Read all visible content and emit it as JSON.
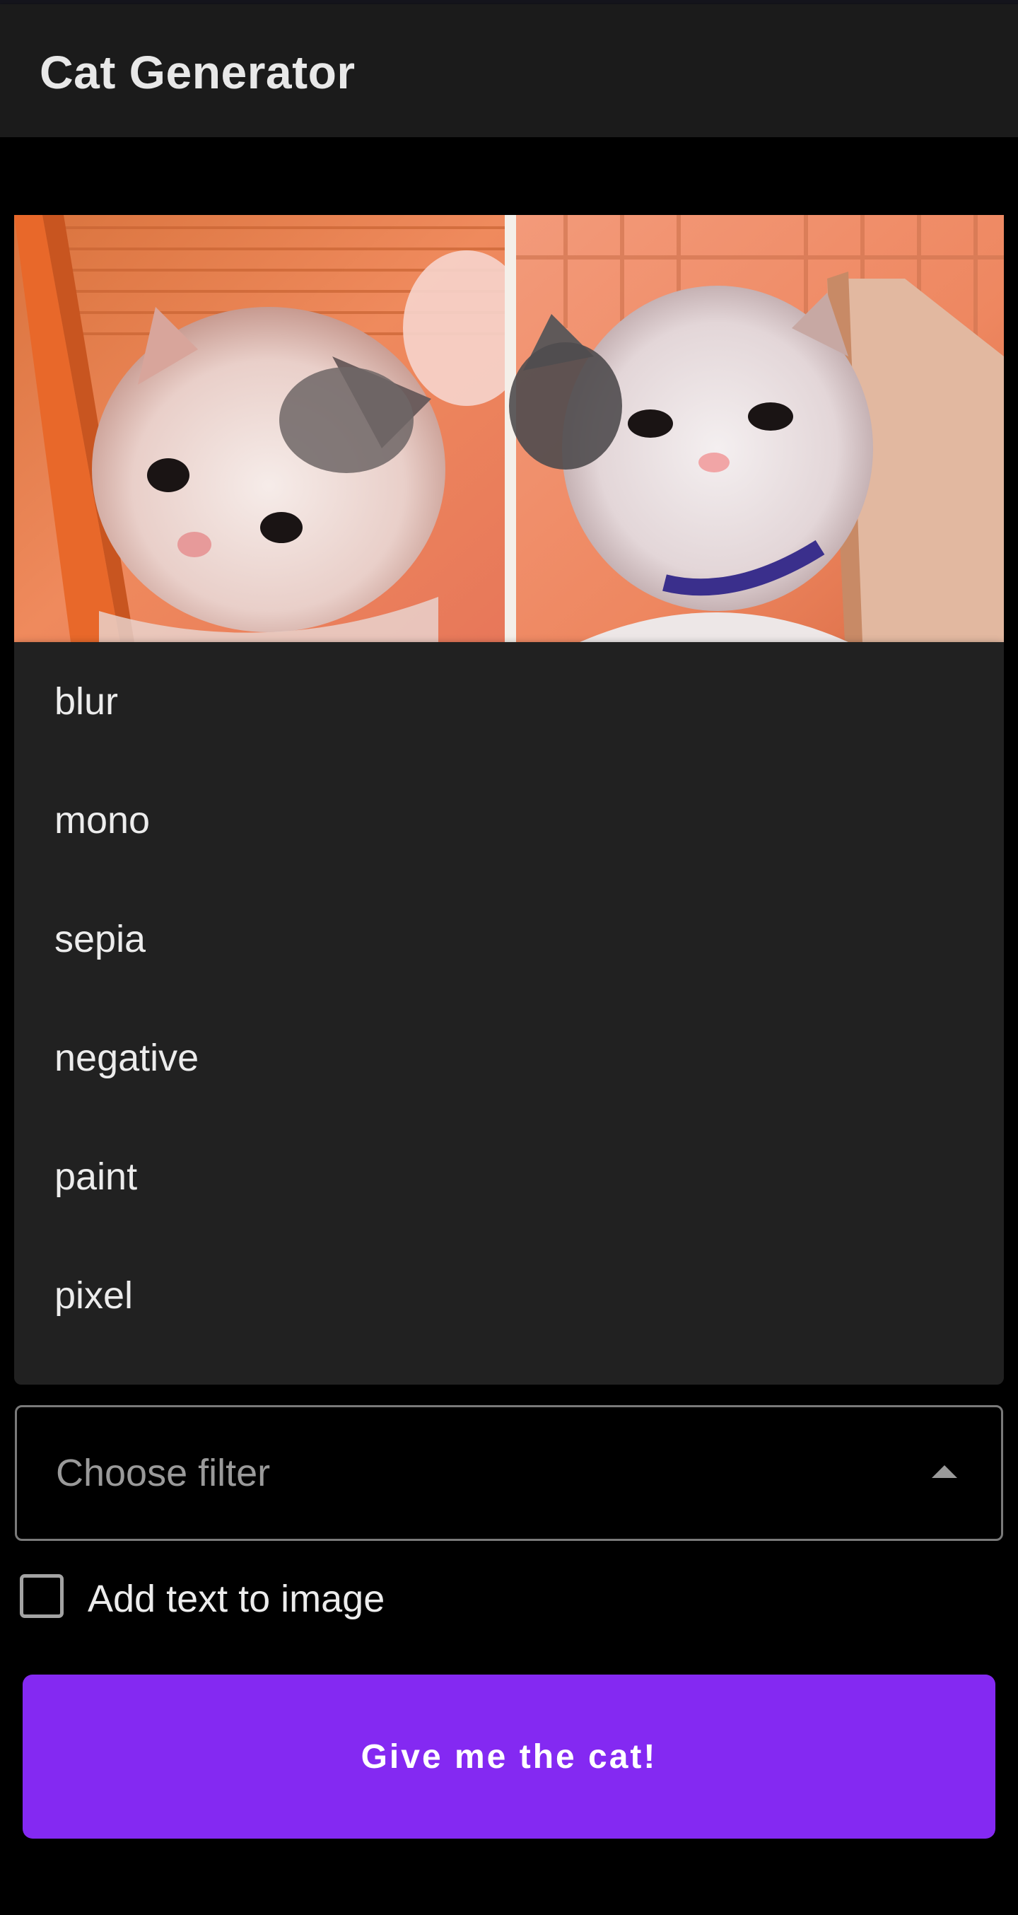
{
  "app": {
    "title": "Cat Generator"
  },
  "preview": {
    "icon": "cat-photo-image"
  },
  "filter_menu": {
    "options": [
      "blur",
      "mono",
      "sepia",
      "negative",
      "paint",
      "pixel"
    ]
  },
  "filter_select": {
    "placeholder": "Choose filter",
    "icon": "caret-up-icon"
  },
  "add_text": {
    "label": "Add text to image",
    "checked": false
  },
  "action": {
    "label": "Give me the cat!"
  },
  "colors": {
    "accent": "#8429f2",
    "surface": "#212121",
    "app_bar": "#1b1b1b",
    "background": "#000000"
  }
}
